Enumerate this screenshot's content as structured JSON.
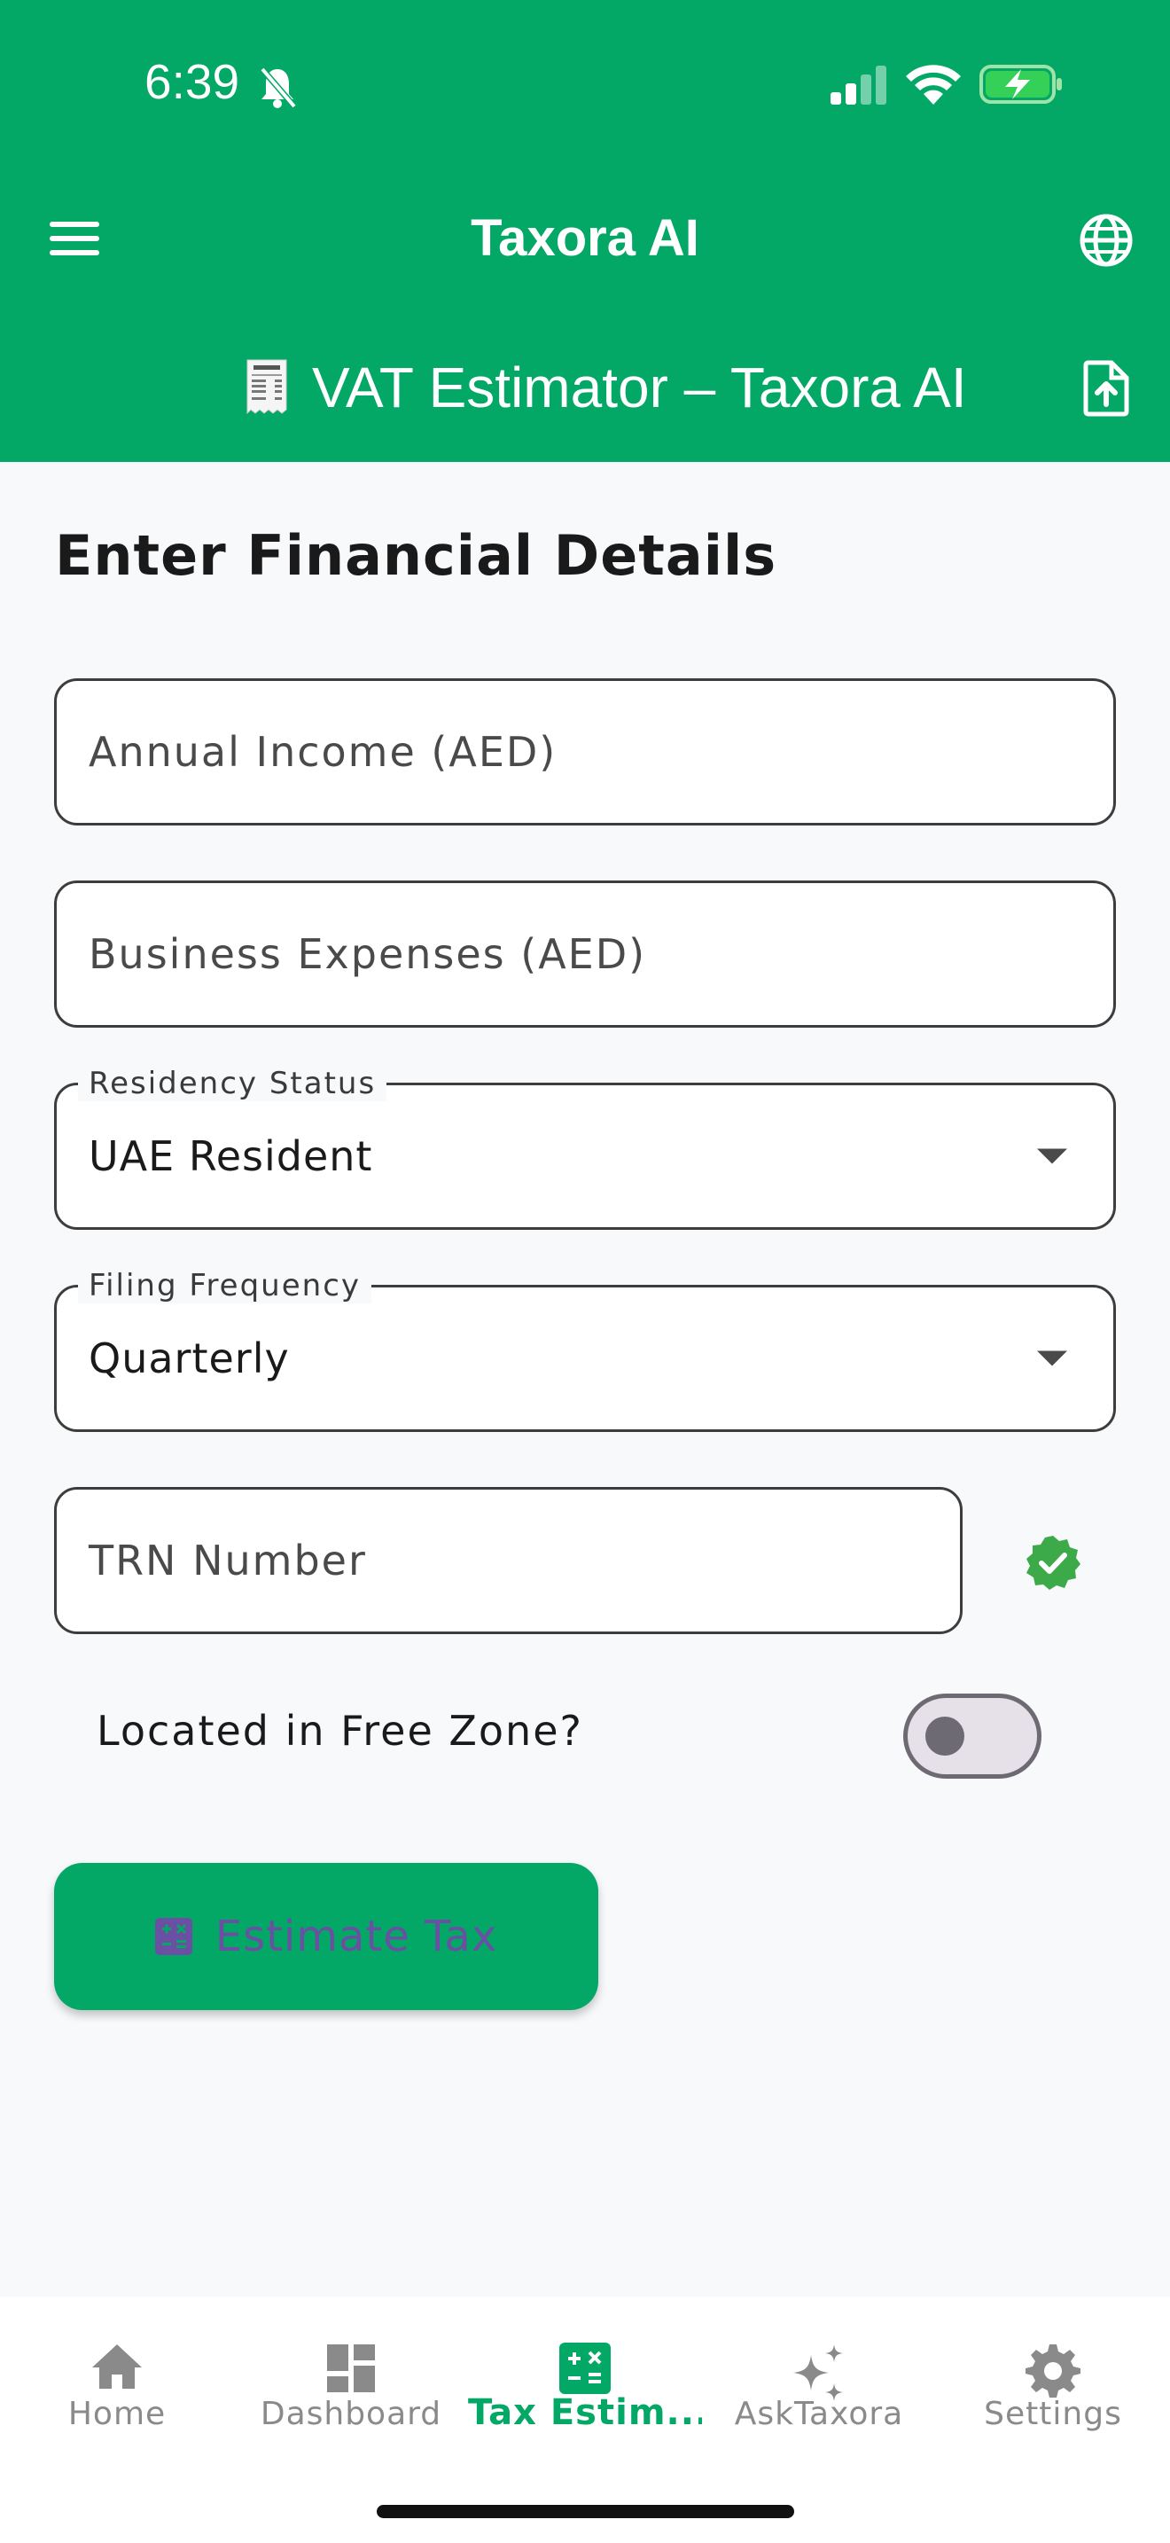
{
  "status_bar": {
    "time": "6:39"
  },
  "header": {
    "app_title": "Taxora AI",
    "sub_title": "VAT Estimator – Taxora AI",
    "menu_icon": "menu-icon",
    "language_icon": "globe-icon",
    "export_icon": "file-upload-icon",
    "bg_color": "#03a866"
  },
  "form": {
    "section_title": "Enter Financial Details",
    "annual_income": {
      "placeholder": "Annual Income (AED)",
      "value": ""
    },
    "business_expenses": {
      "placeholder": "Business Expenses (AED)",
      "value": ""
    },
    "residency": {
      "label": "Residency Status",
      "value": "UAE Resident"
    },
    "filing": {
      "label": "Filing Frequency",
      "value": "Quarterly"
    },
    "trn": {
      "placeholder": "TRN Number",
      "verified_icon": "verified-badge-icon"
    },
    "free_zone": {
      "label": "Located in Free Zone?",
      "enabled": false
    },
    "estimate_button": {
      "label": "Estimate Tax",
      "icon": "calculator-icon"
    }
  },
  "bottom_nav": {
    "items": [
      {
        "label": "Home",
        "icon": "home-icon",
        "active": false
      },
      {
        "label": "Dashboard",
        "icon": "dashboard-icon",
        "active": false
      },
      {
        "label": "Tax Estim...",
        "icon": "calculator-icon",
        "active": true
      },
      {
        "label": "AskTaxora",
        "icon": "sparkle-icon",
        "active": false
      },
      {
        "label": "Settings",
        "icon": "gear-icon",
        "active": false
      }
    ]
  },
  "colors": {
    "accent": "#03a866",
    "verified": "#3daa4a",
    "button_text": "#6a4fa3"
  }
}
